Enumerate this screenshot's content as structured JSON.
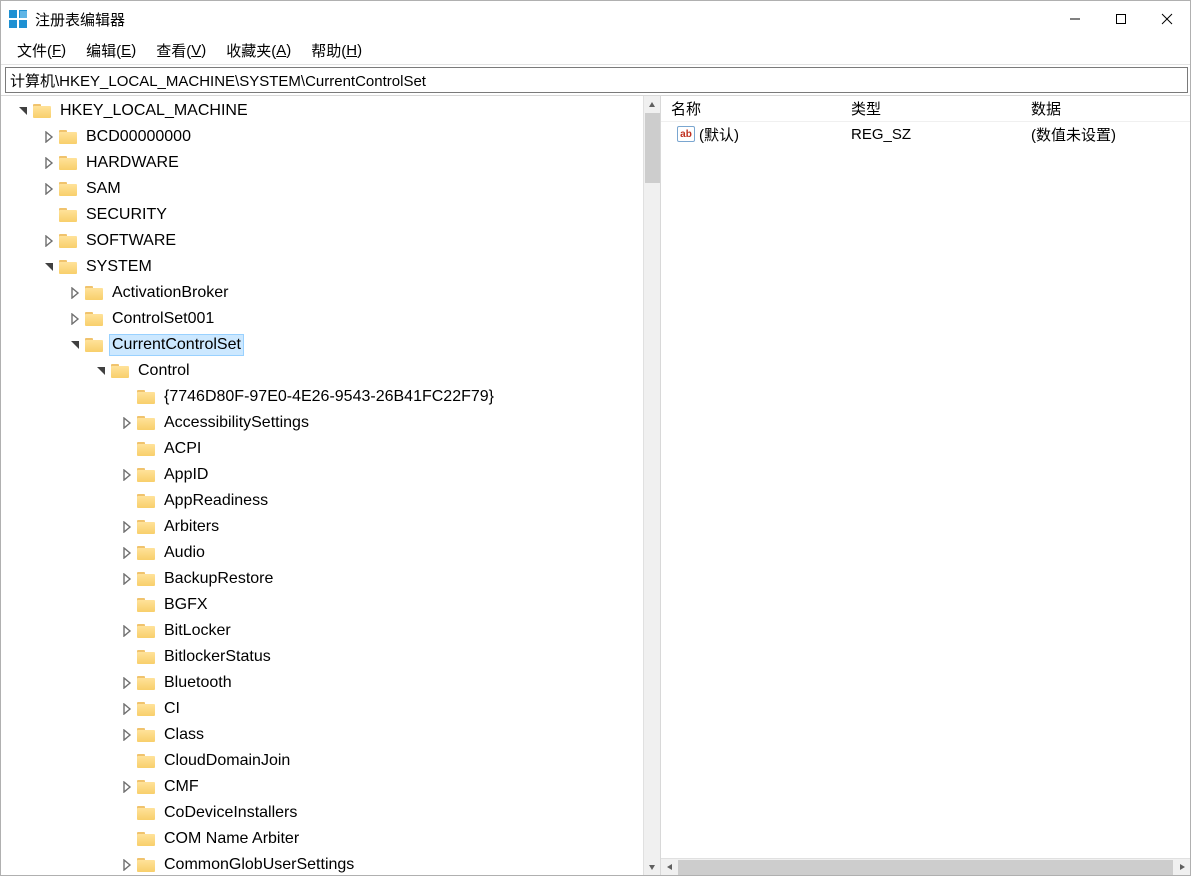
{
  "title": "注册表编辑器",
  "menubar": [
    {
      "label": "文件",
      "acc": "F"
    },
    {
      "label": "编辑",
      "acc": "E"
    },
    {
      "label": "查看",
      "acc": "V"
    },
    {
      "label": "收藏夹",
      "acc": "A"
    },
    {
      "label": "帮助",
      "acc": "H"
    }
  ],
  "address": "计算机\\HKEY_LOCAL_MACHINE\\SYSTEM\\CurrentControlSet",
  "list": {
    "headers": {
      "name": "名称",
      "type": "类型",
      "data": "数据"
    },
    "rows": [
      {
        "name": "(默认)",
        "type": "REG_SZ",
        "data": "(数值未设置)"
      }
    ]
  },
  "tree": [
    {
      "depth": 0,
      "exp": "open",
      "label": "HKEY_LOCAL_MACHINE",
      "sel": false
    },
    {
      "depth": 1,
      "exp": "closed",
      "label": "BCD00000000",
      "sel": false
    },
    {
      "depth": 1,
      "exp": "closed",
      "label": "HARDWARE",
      "sel": false
    },
    {
      "depth": 1,
      "exp": "closed",
      "label": "SAM",
      "sel": false
    },
    {
      "depth": 1,
      "exp": "none",
      "label": "SECURITY",
      "sel": false
    },
    {
      "depth": 1,
      "exp": "closed",
      "label": "SOFTWARE",
      "sel": false
    },
    {
      "depth": 1,
      "exp": "open",
      "label": "SYSTEM",
      "sel": false
    },
    {
      "depth": 2,
      "exp": "closed",
      "label": "ActivationBroker",
      "sel": false
    },
    {
      "depth": 2,
      "exp": "closed",
      "label": "ControlSet001",
      "sel": false
    },
    {
      "depth": 2,
      "exp": "open",
      "label": "CurrentControlSet",
      "sel": true
    },
    {
      "depth": 3,
      "exp": "open",
      "label": "Control",
      "sel": false
    },
    {
      "depth": 4,
      "exp": "none",
      "label": "{7746D80F-97E0-4E26-9543-26B41FC22F79}",
      "sel": false
    },
    {
      "depth": 4,
      "exp": "closed",
      "label": "AccessibilitySettings",
      "sel": false
    },
    {
      "depth": 4,
      "exp": "none",
      "label": "ACPI",
      "sel": false
    },
    {
      "depth": 4,
      "exp": "closed",
      "label": "AppID",
      "sel": false
    },
    {
      "depth": 4,
      "exp": "none",
      "label": "AppReadiness",
      "sel": false
    },
    {
      "depth": 4,
      "exp": "closed",
      "label": "Arbiters",
      "sel": false
    },
    {
      "depth": 4,
      "exp": "closed",
      "label": "Audio",
      "sel": false
    },
    {
      "depth": 4,
      "exp": "closed",
      "label": "BackupRestore",
      "sel": false
    },
    {
      "depth": 4,
      "exp": "none",
      "label": "BGFX",
      "sel": false
    },
    {
      "depth": 4,
      "exp": "closed",
      "label": "BitLocker",
      "sel": false
    },
    {
      "depth": 4,
      "exp": "none",
      "label": "BitlockerStatus",
      "sel": false
    },
    {
      "depth": 4,
      "exp": "closed",
      "label": "Bluetooth",
      "sel": false
    },
    {
      "depth": 4,
      "exp": "closed",
      "label": "CI",
      "sel": false
    },
    {
      "depth": 4,
      "exp": "closed",
      "label": "Class",
      "sel": false
    },
    {
      "depth": 4,
      "exp": "none",
      "label": "CloudDomainJoin",
      "sel": false
    },
    {
      "depth": 4,
      "exp": "closed",
      "label": "CMF",
      "sel": false
    },
    {
      "depth": 4,
      "exp": "none",
      "label": "CoDeviceInstallers",
      "sel": false
    },
    {
      "depth": 4,
      "exp": "none",
      "label": "COM Name Arbiter",
      "sel": false
    },
    {
      "depth": 4,
      "exp": "closed",
      "label": "CommonGlobUserSettings",
      "sel": false
    }
  ]
}
